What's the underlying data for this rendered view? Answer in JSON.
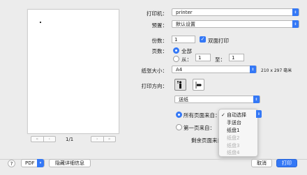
{
  "preview": {
    "page_indicator": "1/1",
    "first_label": "«",
    "prev_label": "‹",
    "next_label": "›",
    "last_label": "»"
  },
  "printer": {
    "label": "打印机：",
    "value": "printer"
  },
  "presets": {
    "label": "预置：",
    "value": "默认设置"
  },
  "copies": {
    "label": "份数：",
    "value": "1",
    "duplex_label": "双面打印",
    "duplex_checked": true
  },
  "pages": {
    "label": "页数：",
    "all_label": "全部",
    "from_label": "从：",
    "from_value": "1",
    "to_label": "至：",
    "to_value": "1"
  },
  "paper_size": {
    "label": "纸张大小：",
    "value": "A4",
    "dimensions": "210 x 297 毫米"
  },
  "orientation": {
    "label": "打印方向："
  },
  "section": {
    "value": "送纸"
  },
  "feed": {
    "all_pages_label": "所有页面来自：",
    "first_page_label": "第一页来自：",
    "remaining_label": "剩余页面来自："
  },
  "menu": {
    "items": [
      {
        "label": "自动选择",
        "checked": true,
        "enabled": true
      },
      {
        "label": "手送台",
        "checked": false,
        "enabled": true
      },
      {
        "label": "纸盘1",
        "checked": false,
        "enabled": true
      },
      {
        "label": "纸盘2",
        "checked": false,
        "enabled": false
      },
      {
        "label": "纸盘3",
        "checked": false,
        "enabled": false
      },
      {
        "label": "纸盘4",
        "checked": false,
        "enabled": false
      }
    ]
  },
  "footer": {
    "help": "?",
    "pdf": "PDF",
    "hide_details": "隐藏详细信息",
    "cancel": "取消",
    "print": "打印"
  },
  "colors": {
    "accent": "#3478f6"
  },
  "icons": {
    "checkmark": "✓",
    "popup_arrows": "⌃⌄"
  }
}
